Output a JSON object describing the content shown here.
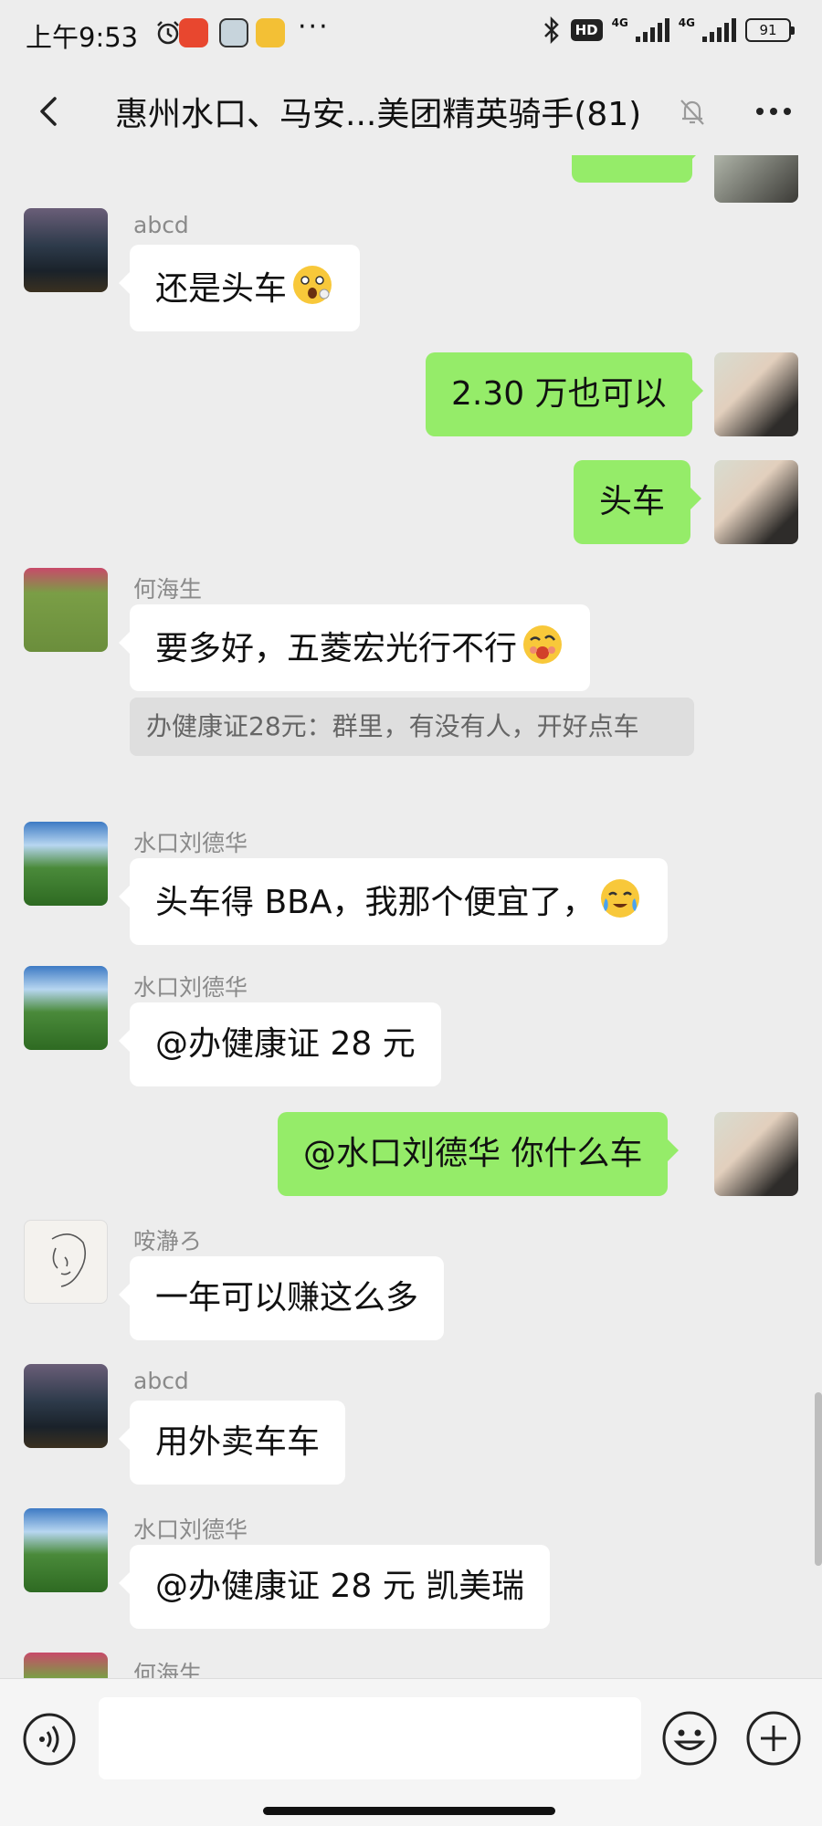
{
  "status_bar": {
    "time": "上午9:53",
    "hd": "HD",
    "network": "4G",
    "battery": "91"
  },
  "header": {
    "title": "惠州水口、马安...美团精英骑手(81)"
  },
  "messages": [
    {
      "sender": "abcd",
      "text": "还是头车",
      "emoji": "surprised-face-emoji"
    },
    {
      "text": "2.30 万也可以",
      "self": true
    },
    {
      "text": "头车",
      "self": true
    },
    {
      "sender": "何海生",
      "text": "要多好，五菱宏光行不行",
      "emoji": "woozy-face-emoji"
    },
    {
      "quote": "办健康证28元：群里，有没有人，开好点车"
    },
    {
      "sender": "水口刘德华",
      "text": "头车得 BBA，我那个便宜了，",
      "emoji": "crying-face-emoji"
    },
    {
      "sender": "水口刘德华",
      "text": "@办健康证 28 元"
    },
    {
      "text": "@水口刘德华  你什么车",
      "self": true
    },
    {
      "sender": "咹瀞ろ",
      "text": "一年可以赚这么多"
    },
    {
      "sender": "abcd",
      "text": "用外卖车车"
    },
    {
      "sender": "水口刘德华",
      "text": "@办健康证 28 元  凯美瑞"
    },
    {
      "sender": "何海生"
    }
  ],
  "input_bar": {
    "voice_icon": "voice-icon",
    "emoji_icon": "emoji-icon",
    "plus_icon": "plus-icon",
    "text_value": ""
  },
  "colors": {
    "background": "#ededed",
    "self_bubble": "#95ec69",
    "other_bubble": "#ffffff",
    "sender_name": "#8a8a8a"
  }
}
